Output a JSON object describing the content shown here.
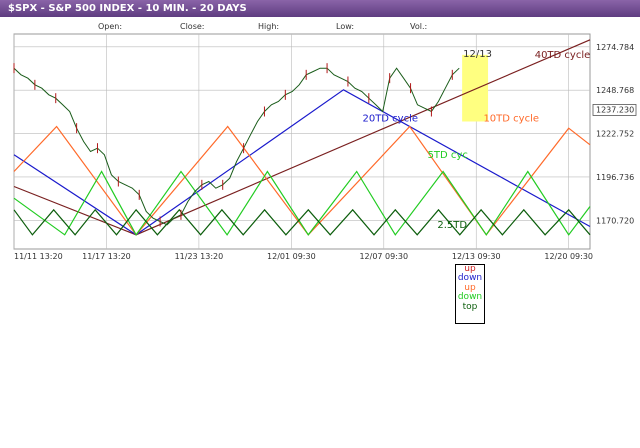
{
  "window": {
    "title": "$SPX - S&P 500 INDEX - 10 MIN. - 20 DAYS"
  },
  "header": {
    "fields": [
      "Open:",
      "Close:",
      "High:",
      "Low:",
      "Vol.:"
    ]
  },
  "chart_data": {
    "type": "line",
    "title": "$SPX - S&P 500 INDEX - 10 MIN. - 20 DAYS",
    "x_ticks": [
      "11/11 13:20",
      "11/17 13:20",
      "11/23 13:20",
      "12/01 09:30",
      "12/07 09:30",
      "12/13 09:30",
      "12/20 09:30"
    ],
    "y_ticks": [
      1170.72,
      1196.736,
      1222.752,
      1248.768,
      1274.784
    ],
    "ylim": [
      1153.5,
      1282.5
    ],
    "last_price": "1237.230",
    "grid": true,
    "price_series": [
      1262,
      1258,
      1256,
      1252,
      1250,
      1246,
      1244,
      1240,
      1236,
      1226,
      1218,
      1212,
      1214,
      1210,
      1198,
      1194,
      1192,
      1190,
      1186,
      1176,
      1172,
      1170,
      1168,
      1172,
      1174,
      1182,
      1188,
      1192,
      1194,
      1190,
      1192,
      1196,
      1206,
      1214,
      1222,
      1230,
      1236,
      1240,
      1242,
      1246,
      1248,
      1252,
      1258,
      1260,
      1262,
      1262,
      1258,
      1256,
      1254,
      1250,
      1248,
      1244,
      1240,
      1236,
      1256,
      1262,
      1256,
      1250,
      1240,
      1238,
      1236,
      1242,
      1250,
      1258,
      1262
    ],
    "cycles": [
      {
        "name": "40TD cycle",
        "color": "#7a2020",
        "points": [
          [
            0.0,
            1191
          ],
          [
            0.212,
            1162
          ],
          [
            1.0,
            1279
          ]
        ]
      },
      {
        "name": "20TD cycle",
        "color": "#1a1acc",
        "points": [
          [
            0.0,
            1210
          ],
          [
            0.212,
            1162
          ],
          [
            0.572,
            1249
          ],
          [
            1.0,
            1167
          ]
        ]
      },
      {
        "name": "10TD cycle",
        "color": "#ff6a2a",
        "points": [
          [
            0.0,
            1200
          ],
          [
            0.074,
            1227
          ],
          [
            0.212,
            1162
          ],
          [
            0.371,
            1227
          ],
          [
            0.511,
            1162
          ],
          [
            0.687,
            1227
          ],
          [
            0.82,
            1162
          ],
          [
            0.963,
            1226
          ],
          [
            1.0,
            1216
          ]
        ]
      },
      {
        "name": "5TD cyc",
        "color": "#22cc22",
        "points": [
          [
            0.0,
            1184
          ],
          [
            0.088,
            1162
          ],
          [
            0.152,
            1200
          ],
          [
            0.212,
            1162
          ],
          [
            0.29,
            1200
          ],
          [
            0.37,
            1162
          ],
          [
            0.44,
            1200
          ],
          [
            0.511,
            1162
          ],
          [
            0.595,
            1200
          ],
          [
            0.662,
            1162
          ],
          [
            0.745,
            1200
          ],
          [
            0.82,
            1162
          ],
          [
            0.892,
            1200
          ],
          [
            0.963,
            1162
          ],
          [
            1.0,
            1179
          ]
        ]
      },
      {
        "name": "2.5TD",
        "color": "#0d5e0d",
        "points": [
          [
            0.0,
            1177
          ],
          [
            0.032,
            1162
          ],
          [
            0.069,
            1177
          ],
          [
            0.106,
            1162
          ],
          [
            0.141,
            1177
          ],
          [
            0.178,
            1162
          ],
          [
            0.212,
            1177
          ],
          [
            0.249,
            1162
          ],
          [
            0.287,
            1177
          ],
          [
            0.324,
            1162
          ],
          [
            0.361,
            1177
          ],
          [
            0.398,
            1162
          ],
          [
            0.435,
            1177
          ],
          [
            0.472,
            1162
          ],
          [
            0.511,
            1177
          ],
          [
            0.549,
            1162
          ],
          [
            0.588,
            1177
          ],
          [
            0.625,
            1162
          ],
          [
            0.662,
            1177
          ],
          [
            0.7,
            1162
          ],
          [
            0.737,
            1177
          ],
          [
            0.774,
            1162
          ],
          [
            0.811,
            1177
          ],
          [
            0.848,
            1162
          ],
          [
            0.885,
            1177
          ],
          [
            0.922,
            1162
          ],
          [
            0.963,
            1177
          ],
          [
            1.0,
            1162
          ]
        ]
      }
    ],
    "highlight": {
      "label": "12/13",
      "x_start": 0.778,
      "x_end": 0.823,
      "y_top": 1270,
      "y_bottom": 1230,
      "color": "#ffff80"
    },
    "annotations": [
      "40TD cycle",
      "20TD cycle",
      "10TD cycle",
      "5TD cyc",
      "2.5TD"
    ]
  },
  "legend": {
    "items": [
      {
        "label": "up",
        "color": "#cc2222"
      },
      {
        "label": "down",
        "color": "#2222cc"
      },
      {
        "label": "up",
        "color": "#ff6a2a"
      },
      {
        "label": "down",
        "color": "#22cc22"
      },
      {
        "label": "top",
        "color": "#0d5e0d"
      }
    ]
  }
}
